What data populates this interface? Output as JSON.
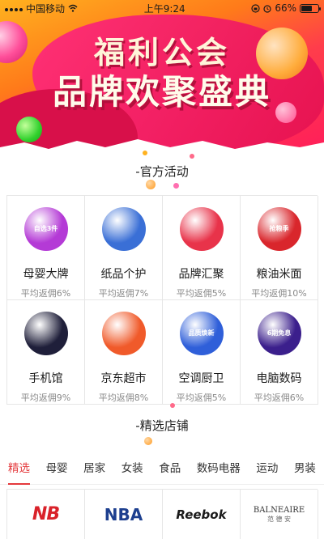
{
  "status_bar": {
    "carrier": "中国移动",
    "time": "上午9:24",
    "battery": "66%",
    "battery_level": 0.66
  },
  "banner": {
    "line1": "福利公会",
    "line2": "品牌欢聚盛典"
  },
  "official_activities": {
    "title": "-官方活动",
    "items": [
      {
        "name": "母婴大牌",
        "rebate": "平均返佣6%",
        "icon_text": "自选3件",
        "color": "#b43ad6"
      },
      {
        "name": "纸品个护",
        "rebate": "平均返佣7%",
        "icon_text": "",
        "color": "#3a6fd6"
      },
      {
        "name": "品牌汇聚",
        "rebate": "平均返佣5%",
        "icon_text": "",
        "color": "#e8334a"
      },
      {
        "name": "粮油米面",
        "rebate": "平均返佣10%",
        "icon_text": "抢粮季",
        "color": "#d9262c"
      },
      {
        "name": "手机馆",
        "rebate": "平均返佣9%",
        "icon_text": "",
        "color": "#1f1f3a"
      },
      {
        "name": "京东超市",
        "rebate": "平均返佣8%",
        "icon_text": "",
        "color": "#f05a2a"
      },
      {
        "name": "空调厨卫",
        "rebate": "平均返佣5%",
        "icon_text": "品质焕新",
        "color": "#2f5fd9"
      },
      {
        "name": "电脑数码",
        "rebate": "平均返佣6%",
        "icon_text": "6期免息",
        "color": "#3b1f8c"
      }
    ]
  },
  "selected_stores": {
    "title": "-精选店铺",
    "tabs": [
      "精选",
      "母婴",
      "居家",
      "女装",
      "食品",
      "数码电器",
      "运动",
      "男装"
    ],
    "active_tab": 0,
    "brands": [
      {
        "logo": "NB",
        "color": "#d9222a"
      },
      {
        "logo": "NBA",
        "color": "#1d3f8f"
      },
      {
        "logo": "Reebok",
        "color": "#1a1a1a"
      },
      {
        "logo": "BALNEAIRE",
        "sub": "范 德 安",
        "color": "#333333"
      }
    ]
  }
}
